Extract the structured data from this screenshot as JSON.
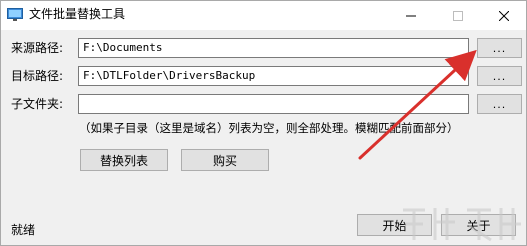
{
  "window": {
    "title": "文件批量替换工具"
  },
  "fields": {
    "source_label": "来源路径:",
    "source_value": "F:\\Documents",
    "target_label": "目标路径:",
    "target_value": "F:\\DTLFolder\\DriversBackup",
    "subfolder_label": "子文件夹:",
    "subfolder_value": "",
    "browse_label": "..."
  },
  "hint": "（如果子目录（这里是域名）列表为空，则全部处理。模糊匹配前面部分）",
  "buttons": {
    "replace_list": "替换列表",
    "buy": "购买",
    "start": "开始",
    "about": "关于"
  },
  "status": {
    "text": "就绪"
  },
  "colors": {
    "arrow": "#d9302c",
    "window_bg": "#f0f0f0",
    "titlebar_bg": "#ffffff"
  },
  "icons": {
    "app": "monitor-icon",
    "minimize": "minimize-icon",
    "maximize": "maximize-icon",
    "close": "close-icon",
    "annotation": "red-arrow-annotation"
  }
}
